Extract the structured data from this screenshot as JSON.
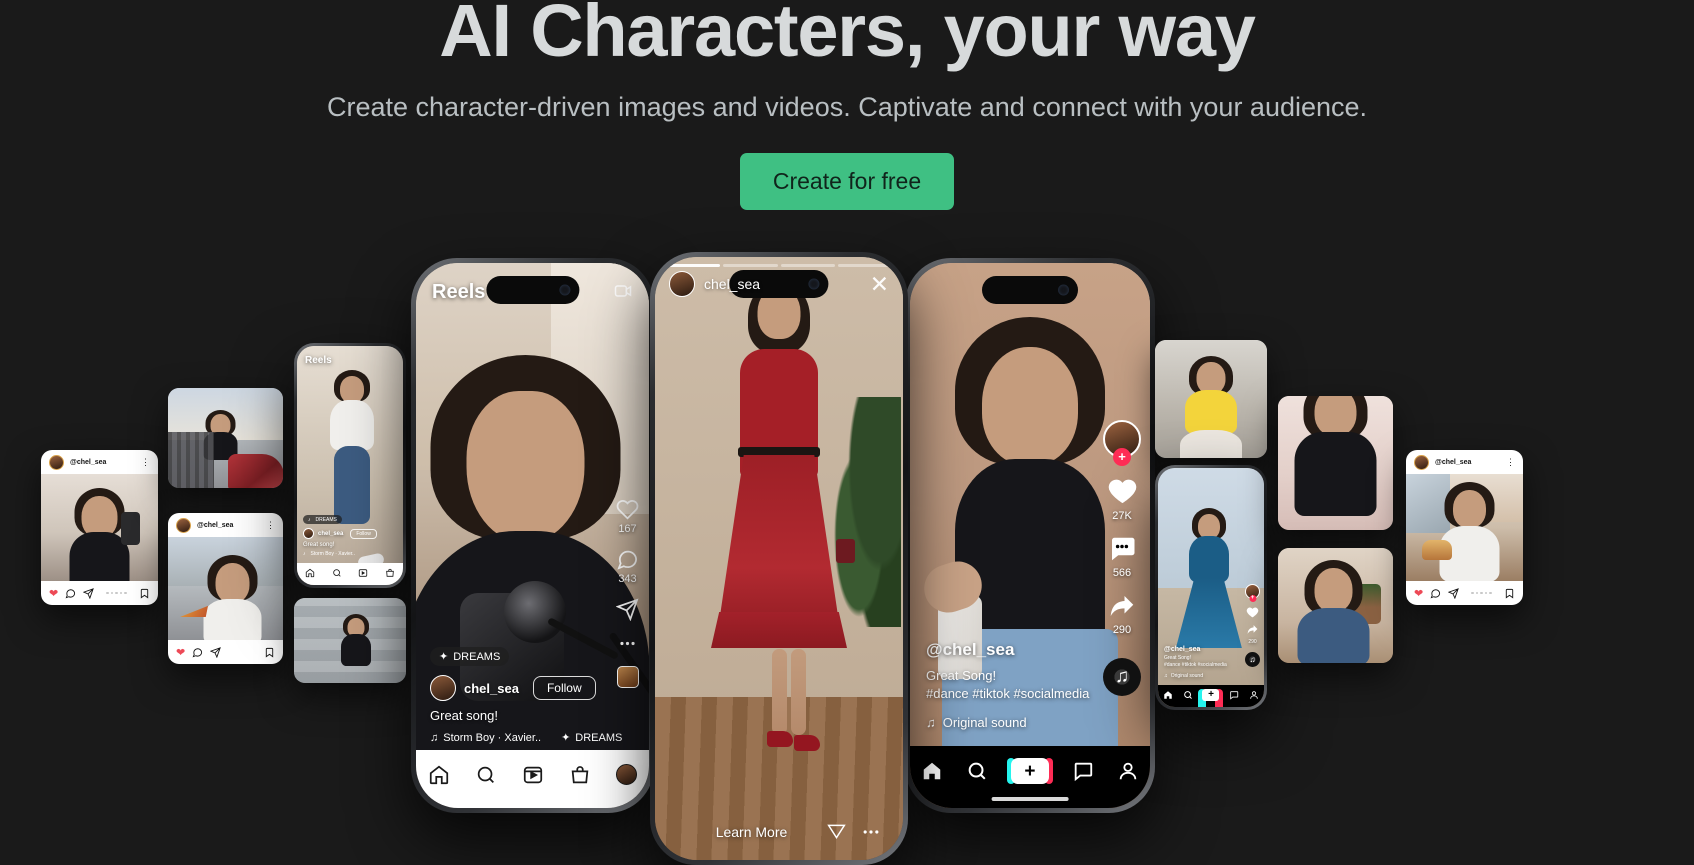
{
  "hero": {
    "title": "AI Characters, your way",
    "subtitle": "Create character-driven images and videos. Captivate and connect with your audience.",
    "cta_label": "Create for free",
    "accent_color": "#3fc083",
    "background_color": "#1a1a1a",
    "title_color": "#d7dadb",
    "subtitle_color": "#b9bfc2"
  },
  "reels_phone": {
    "app_label": "Reels",
    "camera_icon": "camera-icon",
    "badge": "DREAMS",
    "username": "chel_sea",
    "follow_label": "Follow",
    "caption": "Great song!",
    "audio_track": "Storm Boy · Xavier..",
    "audio_tag": "DREAMS",
    "likes": "167",
    "comments": "343",
    "tabs": [
      "home-icon",
      "search-icon",
      "reels-icon",
      "shop-icon",
      "profile-avatar"
    ]
  },
  "story_phone": {
    "username": "chel_sea",
    "close_icon": "close-icon",
    "learn_more": "Learn More",
    "send_icon": "send-icon",
    "more_icon": "more-icon",
    "progress_segments": 4,
    "active_segment": 1
  },
  "tiktok_phone": {
    "username": "@chel_sea",
    "caption_line1": "Great Song!",
    "caption_line2": "#dance #tiktok #socialmedia",
    "sound_label": "Original sound",
    "likes": "27K",
    "comments": "566",
    "shares": "290",
    "follow_plus": "+",
    "tabs": [
      "home-icon",
      "search-icon",
      "create-icon",
      "inbox-icon",
      "profile-icon"
    ]
  },
  "tiktok_mini": {
    "username": "@chel_sea",
    "caption_line1": "Great Song!",
    "caption_line2": "#dance #tiktok #socialmedia",
    "sound_label": "Original sound",
    "shares": "290"
  },
  "reels_mini": {
    "app_label": "Reels",
    "badge": "DREAMS",
    "username": "chel_sea",
    "follow_label": "Follow",
    "caption": "Great song!",
    "audio_track": "Storm Boy · Xavier.."
  },
  "feed_cards": [
    {
      "id": "left-far",
      "username": "@chel_sea",
      "scene": "mirror-selfie-black-top"
    },
    {
      "id": "left-near",
      "username": "@chel_sea",
      "scene": "pizza-street-white-top"
    },
    {
      "id": "right-far",
      "username": "@chel_sea",
      "scene": "cafe-burger-black-top"
    }
  ],
  "photo_cards": [
    {
      "id": "left-bridge",
      "scene": "bridge-floral-skirt"
    },
    {
      "id": "left-steps",
      "scene": "steps-black-top"
    },
    {
      "id": "right-yellow",
      "scene": "yellow-top-street"
    },
    {
      "id": "right-blue-beach",
      "scene": "blue-dress-beach"
    },
    {
      "id": "right-sport",
      "scene": "black-sports-top"
    },
    {
      "id": "right-denim",
      "scene": "denim-jacket-indoor"
    }
  ]
}
